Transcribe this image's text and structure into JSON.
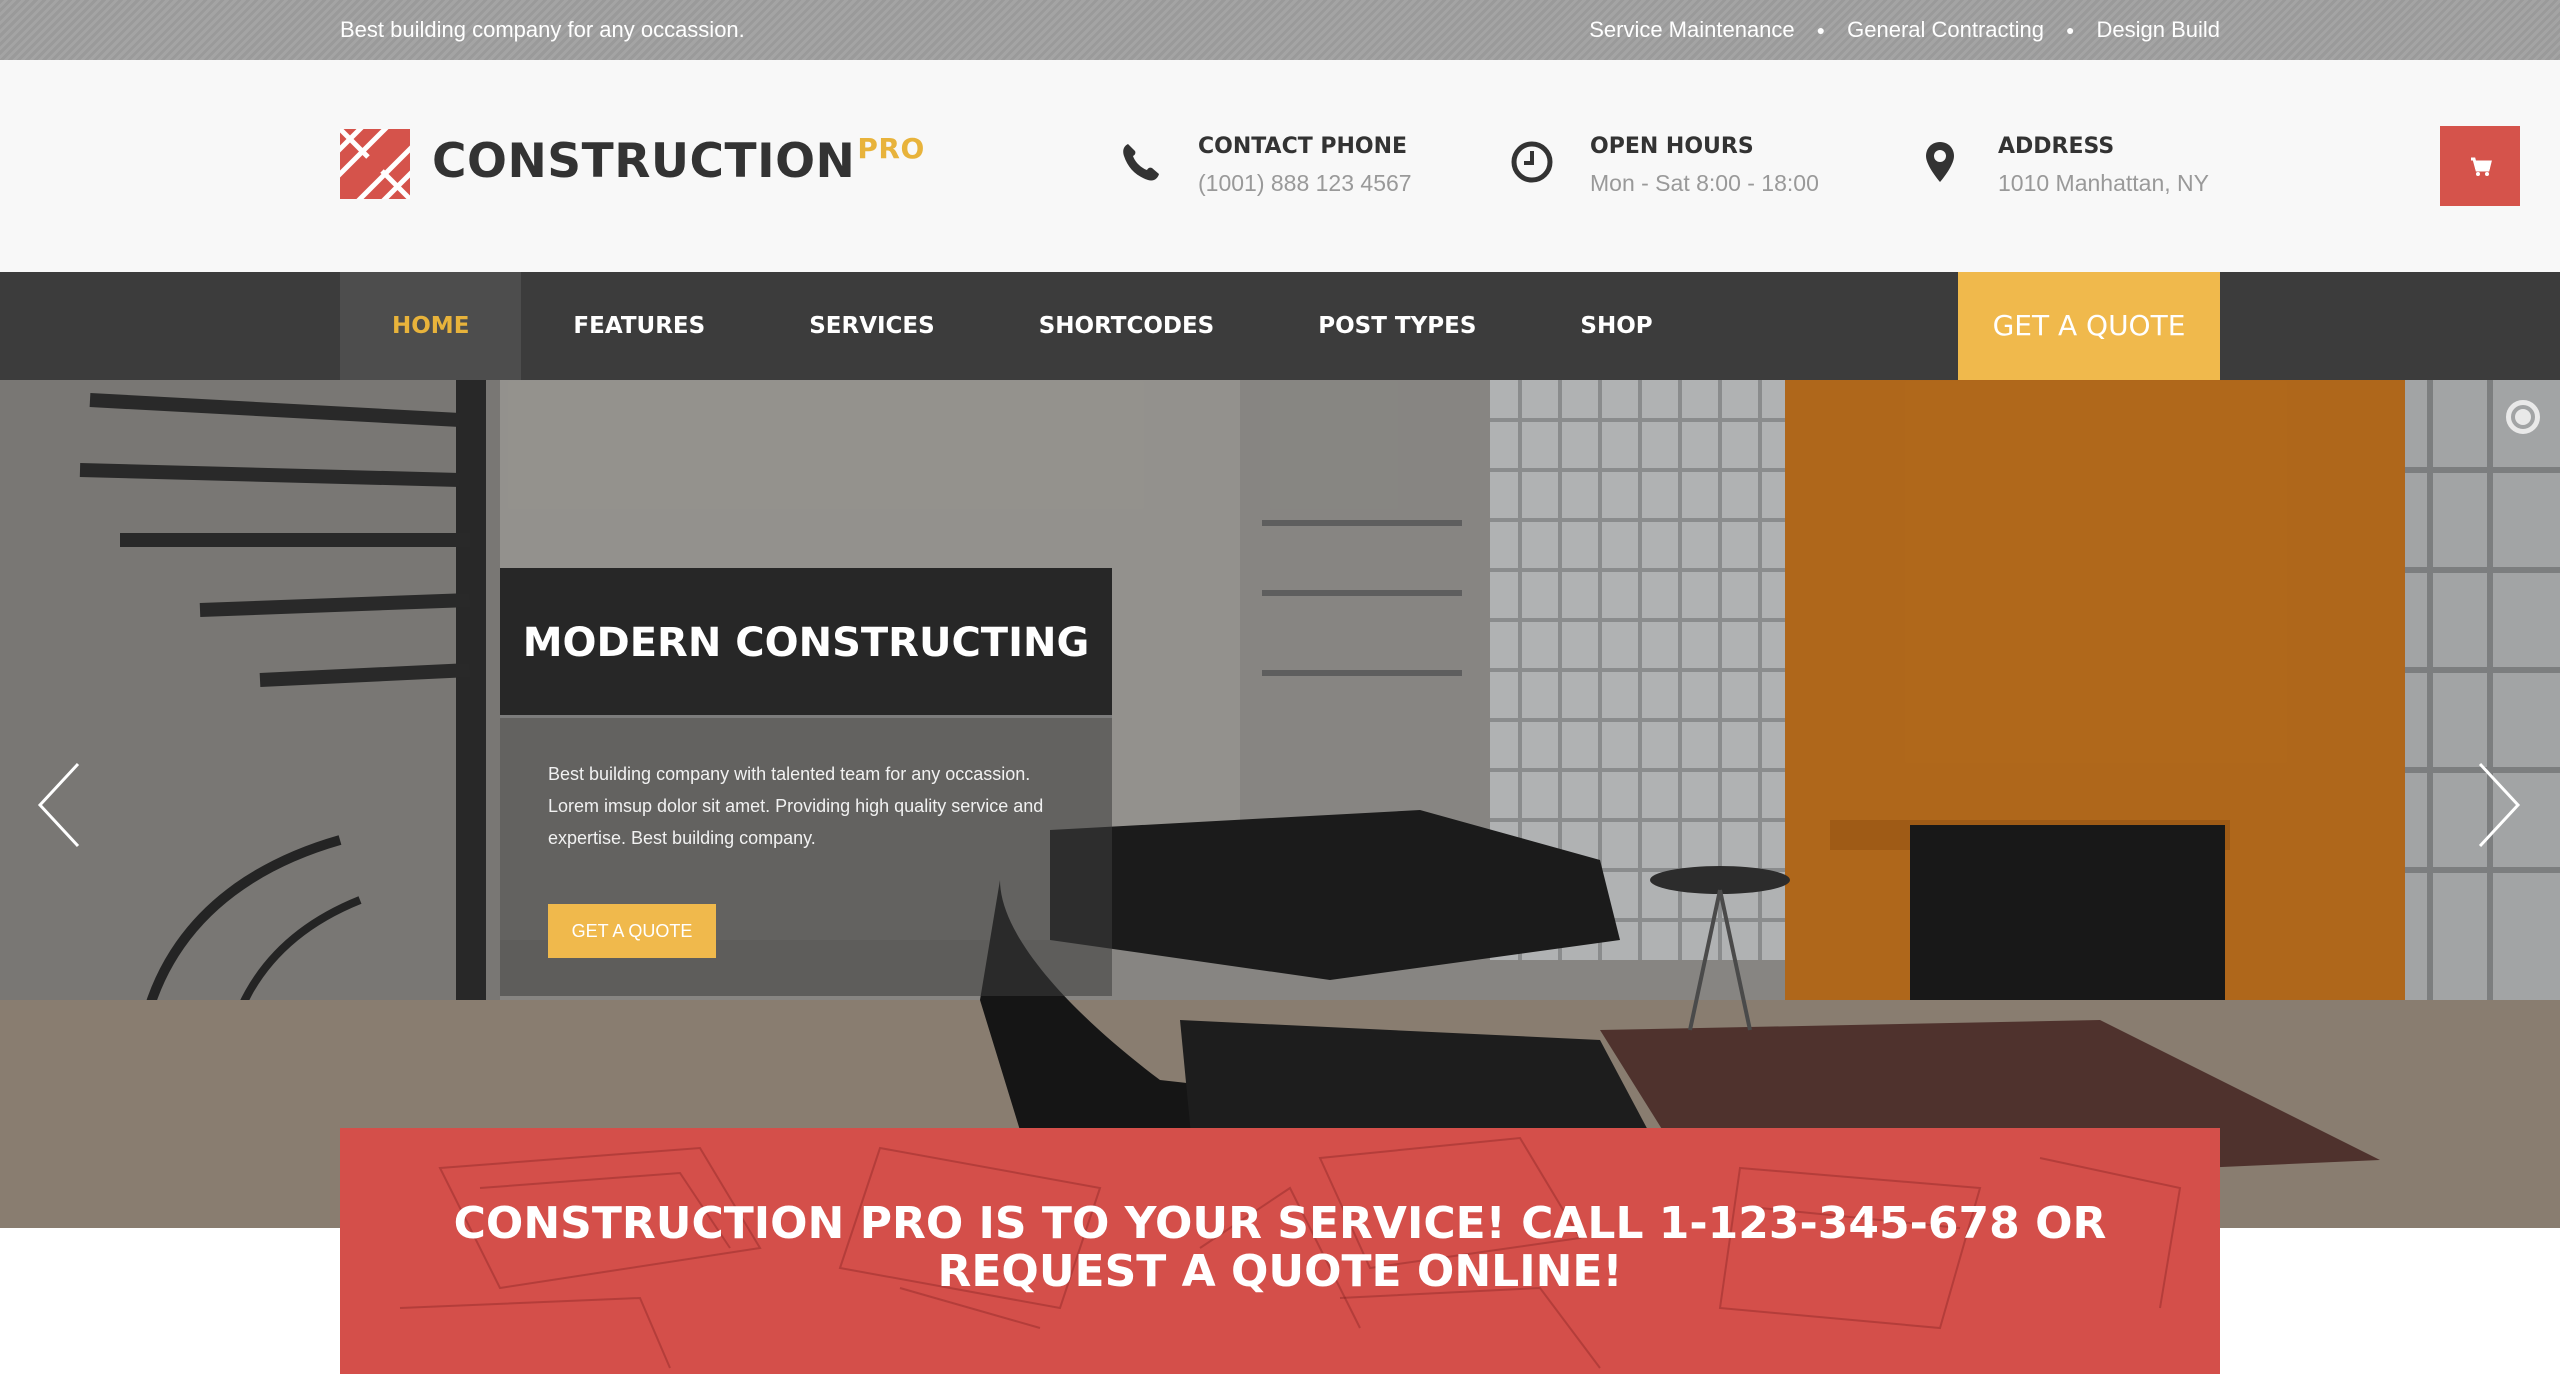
{
  "topbar": {
    "tagline": "Best building company for any occassion.",
    "links": [
      "Service Maintenance",
      "General Contracting",
      "Design Build"
    ]
  },
  "header": {
    "logo_main": "CONSTRUCTION",
    "logo_sup": "PRO",
    "contact": {
      "title": "CONTACT PHONE",
      "value": "(1001) 888 123 4567"
    },
    "hours": {
      "title": "OPEN HOURS",
      "value": "Mon - Sat 8:00 - 18:00"
    },
    "address": {
      "title": "ADDRESS",
      "value": "1010 Manhattan, NY"
    }
  },
  "nav": {
    "items": [
      "HOME",
      "FEATURES",
      "SERVICES",
      "SHORTCODES",
      "POST TYPES",
      "SHOP"
    ],
    "active_index": 0,
    "quote": "GET A QUOTE"
  },
  "hero": {
    "title": "MODERN CONSTRUCTING",
    "description": "Best building company with talented team for any occassion. Lorem imsup dolor sit amet. Providing high quality service and expertise. Best building company.",
    "button": "GET A QUOTE"
  },
  "banner": {
    "text": "CONSTRUCTION PRO IS TO YOUR SERVICE! CALL 1-123-345-678 OR REQUEST A QUOTE ONLINE!"
  },
  "icons": {
    "phone": "phone-icon",
    "clock": "clock-icon",
    "pin": "map-pin-icon",
    "cart": "shopping-cart-icon"
  },
  "colors": {
    "accent_yellow": "#f0b94c",
    "brand_red": "#d5534b",
    "nav_dark": "#3c3c3c"
  }
}
